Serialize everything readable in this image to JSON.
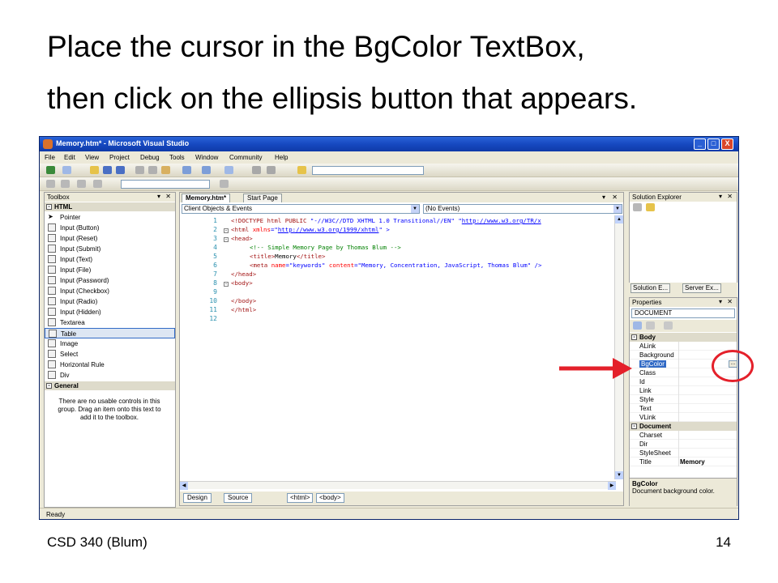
{
  "slide": {
    "title_line1": "Place the cursor in the BgColor TextBox,",
    "title_line2": "then click on the ellipsis button that appears.",
    "footer_left": "CSD 340 (Blum)",
    "footer_right": "14"
  },
  "window": {
    "title": "Memory.htm* - Microsoft Visual Studio",
    "controls": {
      "minimize": "_",
      "maximize": "□",
      "close": "X"
    }
  },
  "menu": [
    "File",
    "Edit",
    "View",
    "Project",
    "Debug",
    "Tools",
    "Window",
    "Community",
    "Help"
  ],
  "toolbox": {
    "title": "Toolbox",
    "controls": "▾ ✕",
    "html_group": "HTML",
    "items": [
      "Pointer",
      "Input (Button)",
      "Input (Reset)",
      "Input (Submit)",
      "Input (Text)",
      "Input (File)",
      "Input (Password)",
      "Input (Checkbox)",
      "Input (Radio)",
      "Input (Hidden)",
      "Textarea",
      "Table",
      "Image",
      "Select",
      "Horizontal Rule",
      "Div"
    ],
    "selected_item": "Table",
    "general_group": "General",
    "general_empty_message": "There are no usable controls in this group. Drag an item onto this text to add it to the toolbox."
  },
  "editor": {
    "tabs": [
      "Memory.htm*",
      "Start Page"
    ],
    "active_tab": "Memory.htm*",
    "object_combo": "Client Objects & Events",
    "event_combo": "(No Events)",
    "line_numbers": [
      "1",
      "2",
      "3",
      "4",
      "5",
      "6",
      "7",
      "8",
      "9",
      "10",
      "11",
      "12"
    ],
    "code": {
      "l1_a": "<!DOCTYPE html PUBLIC ",
      "l1_b": "\"-//W3C//DTD XHTML 1.0 Transitional//EN\"",
      "l1_c": " \"",
      "l1_link": "http://www.w3.org/TR/x",
      "l2_a": "<html ",
      "l2_attr": "xmlns",
      "l2_b": "=\"",
      "l2_link": "http://www.w3.org/1999/xhtml",
      "l2_c": "\" >",
      "l3": "<head>",
      "l4": "<!-- Simple Memory Page by Thomas Blum -->",
      "l5_a": "<title>",
      "l5_b": "Memory",
      "l5_c": "</title>",
      "l6_a": "<meta ",
      "l6_attr1": "name",
      "l6_b": "=\"keywords\" ",
      "l6_attr2": "content",
      "l6_c": "=\"Memory, Concentration, JavaScript, Thomas Blum\" />",
      "l7": "</head>",
      "l8": "<body>",
      "l10": "</body>",
      "l11": "</html>"
    },
    "view_design": "Design",
    "view_source": "Source",
    "crumbs": [
      "<html>",
      "<body>"
    ]
  },
  "solution_explorer": {
    "title": "Solution Explorer",
    "tabs": [
      "Solution E...",
      "Server Ex..."
    ]
  },
  "properties": {
    "title": "Properties",
    "object": "DOCUMENT",
    "cat_body": "Body",
    "rows_body": [
      "ALink",
      "Background",
      "BgColor",
      "Class",
      "Id",
      "Link",
      "Style",
      "Text",
      "VLink"
    ],
    "selected_row": "BgColor",
    "ellipsis": "...",
    "cat_document": "Document",
    "rows_document": [
      "Charset",
      "Dir",
      "StyleSheet",
      "Title"
    ],
    "title_value": "Memory",
    "desc_title": "BgColor",
    "desc_text": "Document background color."
  },
  "status": "Ready",
  "colors": {
    "annotation": "#e4202a",
    "titlebar": "#1649c0",
    "selection": "#316ac5"
  }
}
